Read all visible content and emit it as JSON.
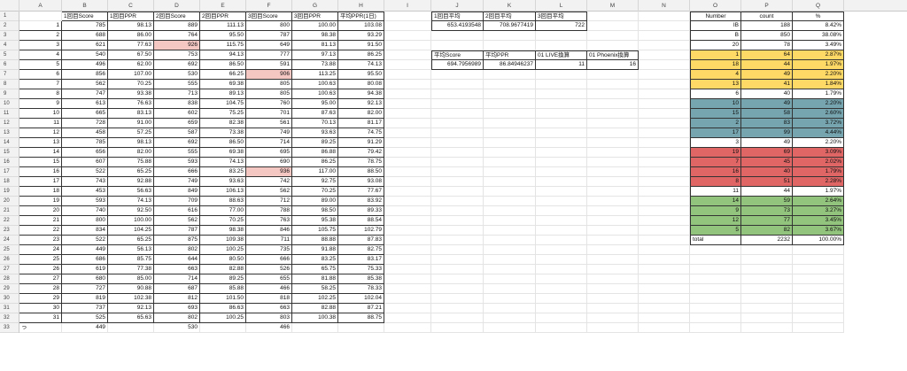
{
  "columns": [
    "A",
    "B",
    "C",
    "D",
    "E",
    "F",
    "G",
    "H",
    "I",
    "J",
    "K",
    "L",
    "M",
    "N",
    "O",
    "P",
    "Q"
  ],
  "rows_count": 33,
  "main_headers": {
    "b": "1回目Score",
    "c": "1回目PPR",
    "d": "2回目Score",
    "e": "2回目PPR",
    "f": "3回目Score",
    "g": "3回目PPR",
    "h": "平均PPR(1日)"
  },
  "main_rows": [
    [
      "1",
      "785",
      "98.13",
      "889",
      "111.13",
      "800",
      "100.00",
      "103.08"
    ],
    [
      "2",
      "688",
      "86.00",
      "764",
      "95.50",
      "787",
      "98.38",
      "93.29"
    ],
    [
      "3",
      "621",
      "77.63",
      "926",
      "115.75",
      "649",
      "81.13",
      "91.50"
    ],
    [
      "4",
      "540",
      "67.50",
      "753",
      "94.13",
      "777",
      "97.13",
      "86.25"
    ],
    [
      "5",
      "496",
      "62.00",
      "692",
      "86.50",
      "591",
      "73.88",
      "74.13"
    ],
    [
      "6",
      "856",
      "107.00",
      "530",
      "66.25",
      "906",
      "113.25",
      "95.50"
    ],
    [
      "7",
      "562",
      "70.25",
      "555",
      "69.38",
      "805",
      "100.63",
      "80.08"
    ],
    [
      "8",
      "747",
      "93.38",
      "713",
      "89.13",
      "805",
      "100.63",
      "94.38"
    ],
    [
      "9",
      "613",
      "76.63",
      "838",
      "104.75",
      "760",
      "95.00",
      "92.13"
    ],
    [
      "10",
      "665",
      "83.13",
      "602",
      "75.25",
      "701",
      "87.63",
      "82.00"
    ],
    [
      "11",
      "728",
      "91.00",
      "659",
      "82.38",
      "561",
      "70.13",
      "81.17"
    ],
    [
      "12",
      "458",
      "57.25",
      "587",
      "73.38",
      "749",
      "93.63",
      "74.75"
    ],
    [
      "13",
      "785",
      "98.13",
      "692",
      "86.50",
      "714",
      "89.25",
      "91.29"
    ],
    [
      "14",
      "656",
      "82.00",
      "555",
      "69.38",
      "695",
      "86.88",
      "79.42"
    ],
    [
      "15",
      "607",
      "75.88",
      "593",
      "74.13",
      "690",
      "86.25",
      "78.75"
    ],
    [
      "16",
      "522",
      "65.25",
      "666",
      "83.25",
      "936",
      "117.00",
      "88.50"
    ],
    [
      "17",
      "743",
      "92.88",
      "749",
      "93.63",
      "742",
      "92.75",
      "93.08"
    ],
    [
      "18",
      "453",
      "56.63",
      "849",
      "106.13",
      "562",
      "70.25",
      "77.67"
    ],
    [
      "19",
      "593",
      "74.13",
      "709",
      "88.63",
      "712",
      "89.00",
      "83.92"
    ],
    [
      "20",
      "740",
      "92.50",
      "616",
      "77.00",
      "788",
      "98.50",
      "89.33"
    ],
    [
      "21",
      "800",
      "100.00",
      "562",
      "70.25",
      "763",
      "95.38",
      "88.54"
    ],
    [
      "22",
      "834",
      "104.25",
      "787",
      "98.38",
      "846",
      "105.75",
      "102.79"
    ],
    [
      "23",
      "522",
      "65.25",
      "875",
      "109.38",
      "711",
      "88.88",
      "87.83"
    ],
    [
      "24",
      "449",
      "56.13",
      "802",
      "100.25",
      "735",
      "91.88",
      "82.75"
    ],
    [
      "25",
      "686",
      "85.75",
      "644",
      "80.50",
      "666",
      "83.25",
      "83.17"
    ],
    [
      "26",
      "619",
      "77.38",
      "663",
      "82.88",
      "526",
      "65.75",
      "75.33"
    ],
    [
      "27",
      "680",
      "85.00",
      "714",
      "89.25",
      "655",
      "81.88",
      "85.38"
    ],
    [
      "28",
      "727",
      "90.88",
      "687",
      "85.88",
      "466",
      "58.25",
      "78.33"
    ],
    [
      "29",
      "819",
      "102.38",
      "812",
      "101.50",
      "818",
      "102.25",
      "102.04"
    ],
    [
      "30",
      "737",
      "92.13",
      "693",
      "86.63",
      "663",
      "82.88",
      "87.21"
    ],
    [
      "31",
      "525",
      "65.63",
      "802",
      "100.25",
      "803",
      "100.38",
      "88.75"
    ]
  ],
  "row33": {
    "a": "っ",
    "b": "449",
    "d": "530",
    "f": "466"
  },
  "avg_block": {
    "headers": [
      "1回目平均",
      "2回目平均",
      "3回目平均"
    ],
    "values": [
      "653.4193548",
      "708.9677419",
      "722"
    ]
  },
  "avg2_block": {
    "headers": [
      "平均Score",
      "平均PPR",
      "01 LIVE換算",
      "01 Phoenix換算"
    ],
    "values": [
      "694.7956989",
      "86.84946237",
      "11",
      "16"
    ]
  },
  "stat_headers": [
    "Number",
    "count",
    "%"
  ],
  "stat_rows": [
    [
      "IB",
      "188",
      "8.42%",
      ""
    ],
    [
      "B",
      "850",
      "38.08%",
      ""
    ],
    [
      "20",
      "78",
      "3.49%",
      ""
    ],
    [
      "1",
      "64",
      "2.87%",
      "yel"
    ],
    [
      "18",
      "44",
      "1.97%",
      "yel"
    ],
    [
      "4",
      "49",
      "2.20%",
      "yel"
    ],
    [
      "13",
      "41",
      "1.84%",
      "yel"
    ],
    [
      "6",
      "40",
      "1.79%",
      ""
    ],
    [
      "10",
      "49",
      "2.20%",
      "teal"
    ],
    [
      "15",
      "58",
      "2.60%",
      "teal"
    ],
    [
      "2",
      "83",
      "3.72%",
      "teal"
    ],
    [
      "17",
      "99",
      "4.44%",
      "teal"
    ],
    [
      "3",
      "49",
      "2.20%",
      ""
    ],
    [
      "19",
      "69",
      "3.09%",
      "red"
    ],
    [
      "7",
      "45",
      "2.02%",
      "red"
    ],
    [
      "16",
      "40",
      "1.79%",
      "red"
    ],
    [
      "8",
      "51",
      "2.28%",
      "red"
    ],
    [
      "11",
      "44",
      "1.97%",
      ""
    ],
    [
      "14",
      "59",
      "2.64%",
      "grn"
    ],
    [
      "9",
      "73",
      "3.27%",
      "grn"
    ],
    [
      "12",
      "77",
      "3.45%",
      "grn"
    ],
    [
      "5",
      "82",
      "3.67%",
      "grn"
    ]
  ],
  "stat_total": [
    "total",
    "2232",
    "100.00%"
  ]
}
